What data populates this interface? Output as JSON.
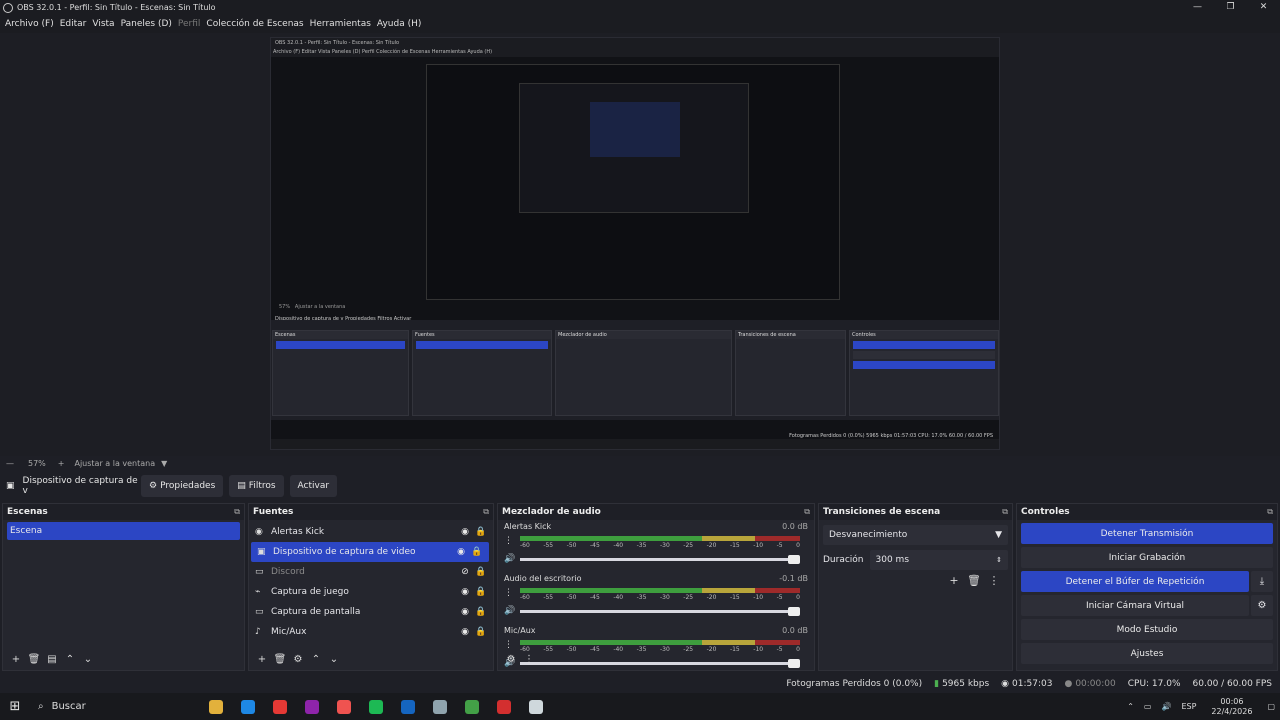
{
  "window": {
    "title": "OBS 32.0.1 - Perfil: Sin Título - Escenas: Sin Título",
    "minimize": "—",
    "restore": "❐",
    "close": "✕"
  },
  "menu": {
    "items": [
      {
        "label": "Archivo (F)",
        "dim": false
      },
      {
        "label": "Editar",
        "dim": false
      },
      {
        "label": "Vista",
        "dim": false
      },
      {
        "label": "Paneles (D)",
        "dim": false
      },
      {
        "label": "Perfil",
        "dim": true
      },
      {
        "label": "Colección de Escenas",
        "dim": false
      },
      {
        "label": "Herramientas",
        "dim": false
      },
      {
        "label": "Ayuda (H)",
        "dim": false
      }
    ]
  },
  "preview_nested": {
    "title": "OBS 32.0.1 - Perfil: Sin Título - Escenas: Sin Título",
    "menu": "Archivo (F)  Editar  Vista  Paneles (D)  Perfil  Colección de Escenas  Herramientas  Ayuda (H)",
    "zoom": "57%",
    "fit": "Ajustar a la ventana",
    "toolbar": "Dispositivo de captura de v   Propiedades   Filtros   Activar",
    "panels": [
      "Escenas",
      "Fuentes",
      "Mezclador de audio",
      "Transiciones de escena",
      "Controles"
    ],
    "status": "Fotogramas Perdidos 0 (0.0%)   5965 kbps   01:57:03   CPU: 17.0%   60.00 / 60.00 FPS"
  },
  "zoom_row": {
    "minus": "—",
    "zoom": "57%",
    "plus": "+",
    "fit": "Ajustar a la ventana",
    "arrow": "▼"
  },
  "toolbar": {
    "source_icon": "▣",
    "source_name": "Dispositivo de captura de v",
    "properties": "Propiedades",
    "filters": "Filtros",
    "activate": "Activar"
  },
  "scenes": {
    "title": "Escenas",
    "undock": "⧉",
    "items": [
      "Escena"
    ]
  },
  "sources": {
    "title": "Fuentes",
    "undock": "⧉",
    "items": [
      {
        "icon": "◉",
        "label": "Alertas Kick",
        "selected": false,
        "dim": false,
        "eye": "◉",
        "lock": "🔒",
        "lockdim": true
      },
      {
        "icon": "▣",
        "label": "Dispositivo de captura de video",
        "selected": true,
        "dim": false,
        "eye": "◉",
        "lock": "🔒",
        "lockdim": true
      },
      {
        "icon": "▭",
        "label": "Discord",
        "selected": false,
        "dim": true,
        "eye": "⊘",
        "lock": "🔒",
        "lockdim": false
      },
      {
        "icon": "⌁",
        "label": "Captura de juego",
        "selected": false,
        "dim": false,
        "eye": "◉",
        "lock": "🔒",
        "lockdim": false
      },
      {
        "icon": "▭",
        "label": "Captura de pantalla",
        "selected": false,
        "dim": false,
        "eye": "◉",
        "lock": "🔒",
        "lockdim": true
      },
      {
        "icon": "♪",
        "label": "Mic/Aux",
        "selected": false,
        "dim": false,
        "eye": "◉",
        "lock": "🔒",
        "lockdim": false
      }
    ]
  },
  "mixer": {
    "title": "Mezclador de audio",
    "undock": "⧉",
    "ticks": [
      "-60",
      "-55",
      "-50",
      "-45",
      "-40",
      "-35",
      "-30",
      "-25",
      "-20",
      "-15",
      "-10",
      "-5",
      "0"
    ],
    "channels": [
      {
        "name": "Alertas Kick",
        "db": "0.0 dB",
        "volume": 1.0
      },
      {
        "name": "Audio del escritorio",
        "db": "-0.1 dB",
        "volume": 1.0
      },
      {
        "name": "Mic/Aux",
        "db": "0.0 dB",
        "volume": 1.0
      }
    ]
  },
  "transitions": {
    "title": "Transiciones de escena",
    "undock": "⧉",
    "selected": "Desvanecimiento",
    "duration_label": "Duración",
    "duration_value": "300 ms"
  },
  "controls": {
    "title": "Controles",
    "undock": "⧉",
    "stop_stream": "Detener Transmisión",
    "start_record": "Iniciar Grabación",
    "stop_replay": "Detener el Búfer de Repetición",
    "virtual_cam": "Iniciar Cámara Virtual",
    "studio_mode": "Modo Estudio",
    "settings": "Ajustes"
  },
  "status": {
    "dropped": "Fotogramas Perdidos 0 (0.0%)",
    "bitrate": "5965 kbps",
    "stream_time": "01:57:03",
    "record_time": "00:00:00",
    "cpu": "CPU: 17.0%",
    "fps": "60.00 / 60.00 FPS"
  },
  "taskbar": {
    "search": "Buscar",
    "lang": "ESP",
    "time": "00:06",
    "date": "22/4/2026",
    "apps": [
      "#e2b13c",
      "#1e88e5",
      "#e53935",
      "#8e24aa",
      "#ef5350",
      "#1db954",
      "#1565c0",
      "#90a4ae",
      "#43a047",
      "#d32f2f",
      "#cfd8dc"
    ]
  },
  "colors": {
    "accent": "#2c46c4",
    "panel": "#25262e",
    "bg": "#1e1f26"
  }
}
